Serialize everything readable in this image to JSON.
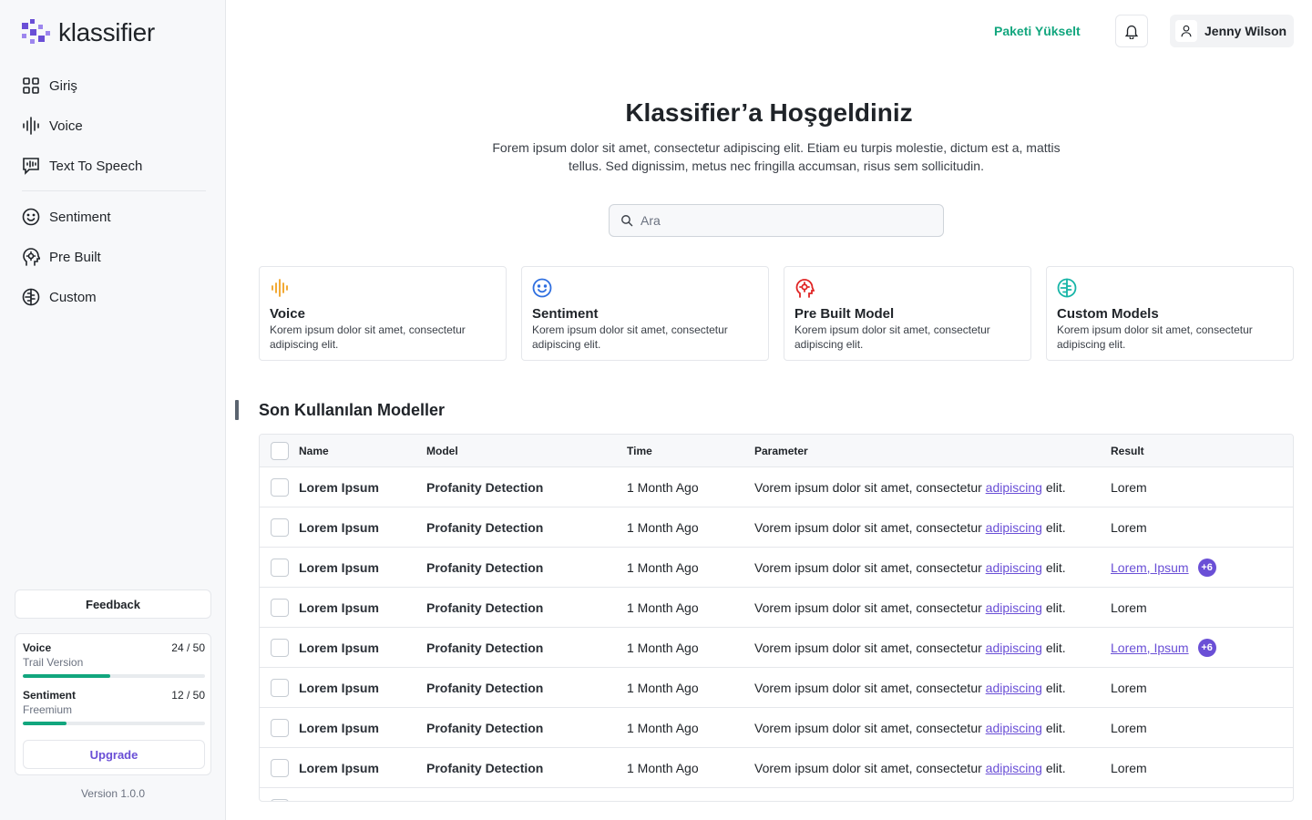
{
  "app": {
    "logo_text": "klassifier"
  },
  "sidebar": {
    "nav": [
      {
        "label": "Giriş",
        "icon": "grid-icon"
      },
      {
        "label": "Voice",
        "icon": "waveform-icon"
      },
      {
        "label": "Text To Speech",
        "icon": "speech-bubble-icon"
      },
      {
        "label": "Sentiment",
        "icon": "smile-icon"
      },
      {
        "label": "Pre Built",
        "icon": "head-icon"
      },
      {
        "label": "Custom",
        "icon": "brain-icon"
      }
    ],
    "feedback_label": "Feedback",
    "usage": [
      {
        "name": "Voice",
        "plan": "Trail Version",
        "count": "24 / 50",
        "used": 24,
        "total": 50
      },
      {
        "name": "Sentiment",
        "plan": "Freemium",
        "count": "12 / 50",
        "used": 12,
        "total": 50
      }
    ],
    "upgrade_label": "Upgrade",
    "version": "Version 1.0.0"
  },
  "header": {
    "upgrade_link": "Paketi Yükselt",
    "user_name": "Jenny Wilson"
  },
  "hero": {
    "title": "Klassifier’a Hoşgeldiniz",
    "description": "Forem ipsum dolor sit amet, consectetur adipiscing elit. Etiam eu turpis molestie, dictum est a, mattis tellus. Sed dignissim, metus nec fringilla accumsan, risus sem sollicitudin.",
    "search_placeholder": "Ara"
  },
  "cards": [
    {
      "title": "Voice",
      "desc": "Korem ipsum dolor sit amet, consectetur adipiscing elit.",
      "icon": "waveform-icon",
      "color": "#f0a020"
    },
    {
      "title": "Sentiment",
      "desc": "Korem ipsum dolor sit amet, consectetur adipiscing elit.",
      "icon": "smile-icon",
      "color": "#2f6fe0"
    },
    {
      "title": "Pre Built Model",
      "desc": "Korem ipsum dolor sit amet, consectetur adipiscing elit.",
      "icon": "head-icon",
      "color": "#e02424"
    },
    {
      "title": "Custom Models",
      "desc": "Korem ipsum dolor sit amet, consectetur adipiscing elit.",
      "icon": "brain-icon",
      "color": "#17b5a7"
    }
  ],
  "recent": {
    "title": "Son Kullanılan Modeller",
    "columns": [
      "Name",
      "Model",
      "Time",
      "Parameter",
      "Result"
    ],
    "rows": [
      {
        "name": "Lorem Ipsum",
        "model": "Profanity Detection",
        "time": "1 Month Ago",
        "param_pre": "Vorem ipsum dolor sit amet, consectetur ",
        "param_link": "adipiscing",
        "param_post": " elit.",
        "result": "Lorem"
      },
      {
        "name": "Lorem Ipsum",
        "model": "Profanity Detection",
        "time": "1 Month Ago",
        "param_pre": "Vorem ipsum dolor sit amet, consectetur ",
        "param_link": "adipiscing",
        "param_post": " elit.",
        "result": "Lorem"
      },
      {
        "name": "Lorem Ipsum",
        "model": "Profanity Detection",
        "time": "1 Month Ago",
        "param_pre": "Vorem ipsum dolor sit amet, consectetur ",
        "param_link": "adipiscing",
        "param_post": " elit.",
        "result_link": "Lorem, Ipsum",
        "badge": "+6"
      },
      {
        "name": "Lorem Ipsum",
        "model": "Profanity Detection",
        "time": "1 Month Ago",
        "param_pre": "Vorem ipsum dolor sit amet, consectetur ",
        "param_link": "adipiscing",
        "param_post": " elit.",
        "result": "Lorem"
      },
      {
        "name": "Lorem Ipsum",
        "model": "Profanity Detection",
        "time": "1 Month Ago",
        "param_pre": "Vorem ipsum dolor sit amet, consectetur ",
        "param_link": "adipiscing",
        "param_post": " elit.",
        "result_link": "Lorem, Ipsum",
        "badge": "+6"
      },
      {
        "name": "Lorem Ipsum",
        "model": "Profanity Detection",
        "time": "1 Month Ago",
        "param_pre": "Vorem ipsum dolor sit amet, consectetur ",
        "param_link": "adipiscing",
        "param_post": " elit.",
        "result": "Lorem"
      },
      {
        "name": "Lorem Ipsum",
        "model": "Profanity Detection",
        "time": "1 Month Ago",
        "param_pre": "Vorem ipsum dolor sit amet, consectetur ",
        "param_link": "adipiscing",
        "param_post": " elit.",
        "result": "Lorem"
      },
      {
        "name": "Lorem Ipsum",
        "model": "Profanity Detection",
        "time": "1 Month Ago",
        "param_pre": "Vorem ipsum dolor sit amet, consectetur ",
        "param_link": "adipiscing",
        "param_post": " elit.",
        "result": "Lorem"
      }
    ]
  },
  "colors": {
    "accent": "#6a4fd6",
    "green": "#12a67e"
  }
}
